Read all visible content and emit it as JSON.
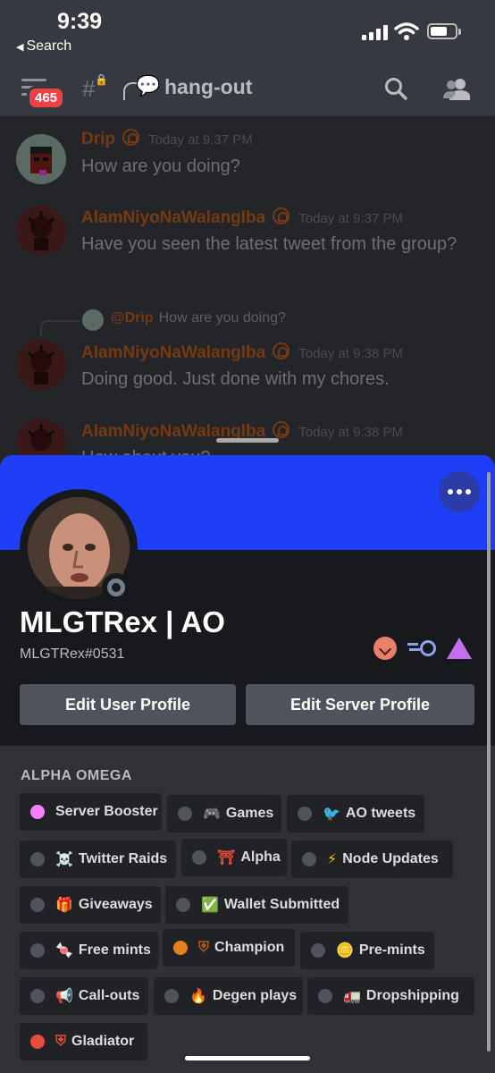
{
  "status_bar": {
    "time": "9:39",
    "back_label": "Search"
  },
  "header": {
    "unread_count": "465",
    "channel_emoji": "💬",
    "channel_name": "hang-out"
  },
  "messages": [
    {
      "author": "Drip",
      "timestamp": "Today at 9:37 PM",
      "text": "How are you doing?"
    },
    {
      "author": "AlamNiyoNaWalangIba",
      "timestamp": "Today at 9:37 PM",
      "text": "Have you seen the latest tweet from the group?"
    },
    {
      "author": "AlamNiyoNaWalangIba",
      "timestamp": "Today at 9:38 PM",
      "text": "Doing good. Just done with my chores.",
      "reply_to": "@Drip",
      "reply_text": "How are you doing?"
    },
    {
      "author": "AlamNiyoNaWalangIba",
      "timestamp": "Today at 9:38 PM",
      "text": "How about you?"
    }
  ],
  "profile": {
    "display_name": "MLGTRex | AO",
    "tag": "MLGTRex#0531",
    "edit_user_label": "Edit User Profile",
    "edit_server_label": "Edit Server Profile",
    "server_name": "ALPHA OMEGA",
    "colors": {
      "banner": "#1e3ff5",
      "accent": "#b55a1d"
    },
    "roles": [
      {
        "label": "Server Booster",
        "icon": "",
        "color": "#f47fff"
      },
      {
        "label": "Games",
        "icon": "🎮",
        "color": "#4f545c"
      },
      {
        "label": "AO tweets",
        "icon": "🐦",
        "color": "#4f545c"
      },
      {
        "label": "Twitter Raids",
        "icon": "☠️",
        "color": "#4f545c"
      },
      {
        "label": "Alpha",
        "icon": "⛩",
        "color": "#4f545c"
      },
      {
        "label": "Node Updates",
        "icon": "⚡",
        "color": "#4f545c"
      },
      {
        "label": "Giveaways",
        "icon": "🎁",
        "color": "#4f545c"
      },
      {
        "label": "Wallet Submitted",
        "icon": "✅",
        "color": "#4f545c"
      },
      {
        "label": "Free mints",
        "icon": "🍬",
        "color": "#4f545c"
      },
      {
        "label": "Champion",
        "icon": "⛨",
        "color": "#e67e22"
      },
      {
        "label": "Pre-mints",
        "icon": "🪙",
        "color": "#4f545c"
      },
      {
        "label": "Call-outs",
        "icon": "📢",
        "color": "#4f545c"
      },
      {
        "label": "Degen plays",
        "icon": "🔥",
        "color": "#4f545c"
      },
      {
        "label": "Dropshipping",
        "icon": "🚛",
        "color": "#4f545c"
      },
      {
        "label": "Gladiator",
        "icon": "⛨",
        "color": "#e74c3c"
      }
    ]
  }
}
